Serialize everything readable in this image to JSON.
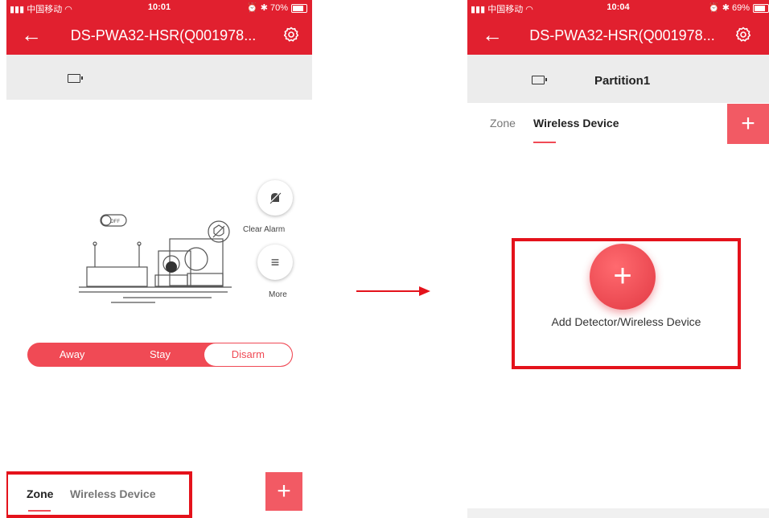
{
  "colors": {
    "brand_red": "#e1202f",
    "accent_red": "#f04a55",
    "highlight_red": "#e4121b"
  },
  "left": {
    "status": {
      "carrier": "中国移动",
      "time": "10:01",
      "battery": "70%"
    },
    "nav": {
      "back_icon": "back-arrow-icon",
      "title": "DS-PWA32-HSR(Q001978...",
      "settings_icon": "gear-icon"
    },
    "illustration": {
      "toggle_text": "OFF"
    },
    "actions": {
      "clear_alarm": "Clear Alarm",
      "more": "More"
    },
    "modes": {
      "away": "Away",
      "stay": "Stay",
      "disarm": "Disarm",
      "selected": "Disarm"
    },
    "tabs": {
      "zone": "Zone",
      "wireless": "Wireless Device",
      "add": "+"
    }
  },
  "right": {
    "status": {
      "carrier": "中国移动",
      "time": "10:04",
      "battery": "69%"
    },
    "nav": {
      "back_icon": "back-arrow-icon",
      "title": "DS-PWA32-HSR(Q001978...",
      "settings_icon": "gear-icon"
    },
    "partition": "Partition1",
    "tabs": {
      "zone": "Zone",
      "wireless": "Wireless Device",
      "add": "+"
    },
    "add_device": {
      "plus": "+",
      "label": "Add Detector/Wireless Device"
    }
  }
}
